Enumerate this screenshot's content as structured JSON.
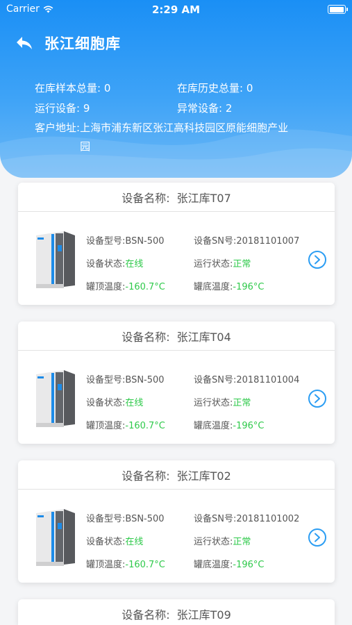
{
  "status_bar": {
    "carrier": "Carrier",
    "time": "2:29 AM"
  },
  "header": {
    "title": "张江细胞库",
    "stats": {
      "stored_total_label": "在库样本总量:",
      "stored_total": "0",
      "history_total_label": "在库历史总量:",
      "history_total": "0",
      "running_label": "运行设备:",
      "running": "9",
      "abnormal_label": "异常设备:",
      "abnormal": "2",
      "address_label": "客户地址:",
      "address": "上海市浦东新区张江高科技园区原能细胞产业园"
    }
  },
  "labels": {
    "device_name": "设备名称:",
    "model": "设备型号:",
    "sn": "设备SN号:",
    "device_status": "设备状态:",
    "run_status": "运行状态:",
    "top_temp": "罐顶温度:",
    "bottom_temp": "罐底温度:"
  },
  "devices": [
    {
      "name": "张江库T07",
      "model": "BSN-500",
      "sn": "20181101007",
      "status": "在线",
      "run_status": "正常",
      "top_temp": "-160.7°C",
      "bottom_temp": "-196°C"
    },
    {
      "name": "张江库T04",
      "model": "BSN-500",
      "sn": "20181101004",
      "status": "在线",
      "run_status": "正常",
      "top_temp": "-160.7°C",
      "bottom_temp": "-196°C"
    },
    {
      "name": "张江库T02",
      "model": "BSN-500",
      "sn": "20181101002",
      "status": "在线",
      "run_status": "正常",
      "top_temp": "-160.7°C",
      "bottom_temp": "-196°C"
    },
    {
      "name": "张江库T09"
    }
  ],
  "colors": {
    "header_blue": "#1a8ff5",
    "status_green": "#2ec94a",
    "link_blue": "#2b9df3"
  }
}
